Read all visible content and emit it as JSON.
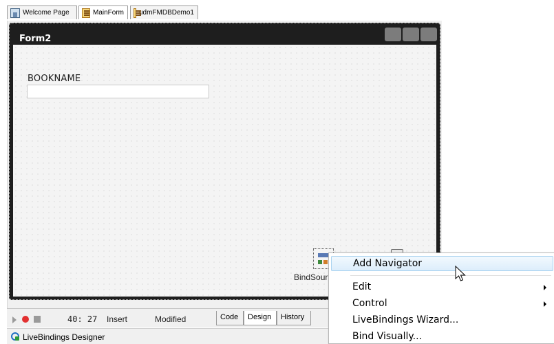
{
  "tabs": [
    {
      "label": "Welcome Page",
      "icon": "home-icon",
      "active": false
    },
    {
      "label": "MainForm",
      "icon": "form-icon",
      "active": true
    },
    {
      "label": "udmFMDBDemo1",
      "icon": "form-icon",
      "active": false
    }
  ],
  "form": {
    "title": "Form2",
    "field_label": "BOOKNAME",
    "field_value": "",
    "component_caption": "BindSour"
  },
  "status": {
    "position": "40: 27",
    "mode": "Insert",
    "state": "Modified",
    "view_tabs": [
      "Code",
      "Design",
      "History"
    ],
    "active_view": "Design"
  },
  "livebindings": {
    "label": "LiveBindings Designer"
  },
  "context_menu": {
    "items": [
      {
        "label": "Add Navigator",
        "highlighted": true,
        "submenu": false
      },
      {
        "label": "Edit",
        "highlighted": false,
        "submenu": true
      },
      {
        "label": "Control",
        "highlighted": false,
        "submenu": true
      },
      {
        "label": "LiveBindings Wizard...",
        "highlighted": false,
        "submenu": false
      },
      {
        "label": "Bind Visually...",
        "highlighted": false,
        "submenu": false
      }
    ]
  },
  "colors": {
    "form_caption": "#1e1e1e",
    "record_indicator": "#e23030",
    "menu_highlight": "#dcedfb"
  }
}
